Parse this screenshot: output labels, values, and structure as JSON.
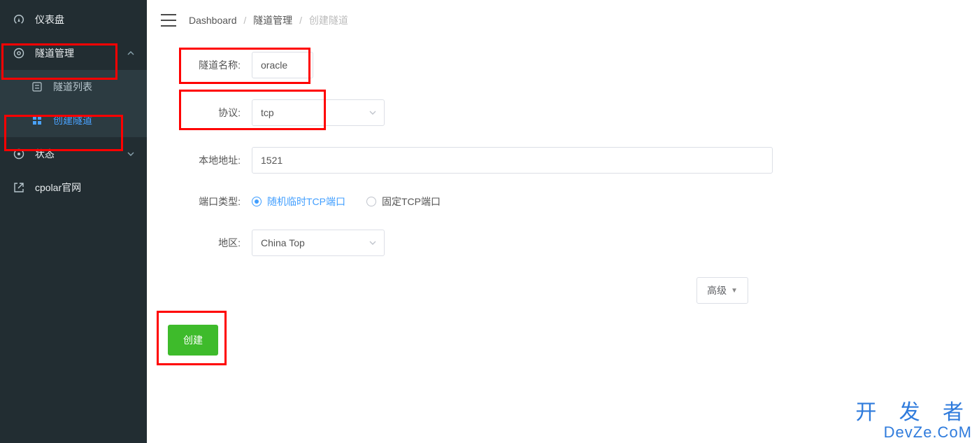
{
  "sidebar": {
    "dashboard": "仪表盘",
    "tunnel_mgmt": "隧道管理",
    "tunnel_list": "隧道列表",
    "create_tunnel": "创建隧道",
    "status": "状态",
    "official_site": "cpolar官网"
  },
  "breadcrumb": {
    "dashboard": "Dashboard",
    "tunnel_mgmt": "隧道管理",
    "create_tunnel": "创建隧道"
  },
  "form": {
    "tunnel_name_label": "隧道名称:",
    "tunnel_name_value": "oracle",
    "protocol_label": "协议:",
    "protocol_value": "tcp",
    "local_addr_label": "本地地址:",
    "local_addr_value": "1521",
    "port_type_label": "端口类型:",
    "port_type_options": {
      "random": "随机临时TCP端口",
      "fixed": "固定TCP端口"
    },
    "port_type_selected": "random",
    "region_label": "地区:",
    "region_value": "China Top",
    "advanced_label": "高级",
    "submit_label": "创建"
  },
  "watermark": {
    "line1": "开 发 者",
    "line2": "DevZe.CoM"
  }
}
